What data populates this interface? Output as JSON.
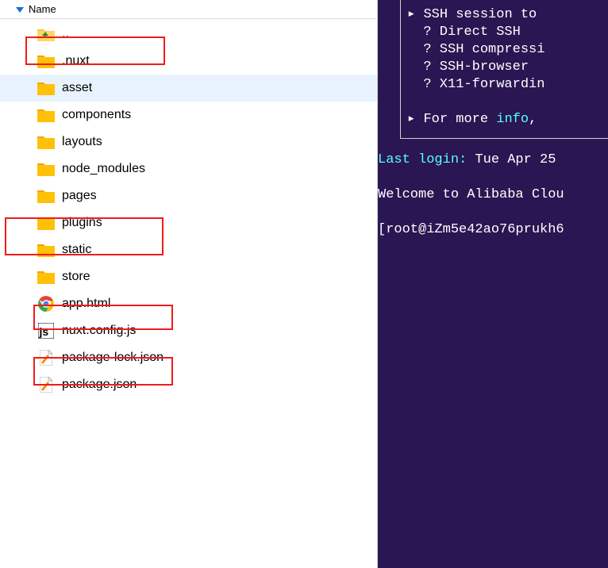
{
  "header": {
    "name_col": "Name"
  },
  "tree": {
    "parent": "..",
    "items": [
      {
        "label": ".nuxt",
        "type": "folder"
      },
      {
        "label": "asset",
        "type": "folder",
        "selected": true
      },
      {
        "label": "components",
        "type": "folder"
      },
      {
        "label": "layouts",
        "type": "folder"
      },
      {
        "label": "node_modules",
        "type": "folder"
      },
      {
        "label": "pages",
        "type": "folder"
      },
      {
        "label": "plugins",
        "type": "folder"
      },
      {
        "label": "static",
        "type": "folder"
      },
      {
        "label": "store",
        "type": "folder"
      },
      {
        "label": "app.html",
        "type": "chrome"
      },
      {
        "label": "nuxt.config.js",
        "type": "js"
      },
      {
        "label": "package-lock.json",
        "type": "file"
      },
      {
        "label": "package.json",
        "type": "file"
      }
    ]
  },
  "highlights": {
    "nuxt": true,
    "static": true,
    "nuxt_config": true,
    "package_json": true
  },
  "terminal": {
    "box": {
      "l1_pre": "▸ ",
      "l1_a": "SSH session to ",
      "l2": "  ? Direct SSH",
      "l3": "  ? SSH compressi",
      "l4": "  ? SSH-browser",
      "l5": "  ? X11-forwardin",
      "l6_pre": "▸ ",
      "l6_a": "For more ",
      "l6_b": "info",
      "l6_c": ", "
    },
    "last_login_label": "Last login:",
    "last_login_value": " Tue Apr 25 ",
    "welcome": "Welcome to Alibaba Clou",
    "prompt": "[root@iZm5e42ao76prukh6"
  }
}
